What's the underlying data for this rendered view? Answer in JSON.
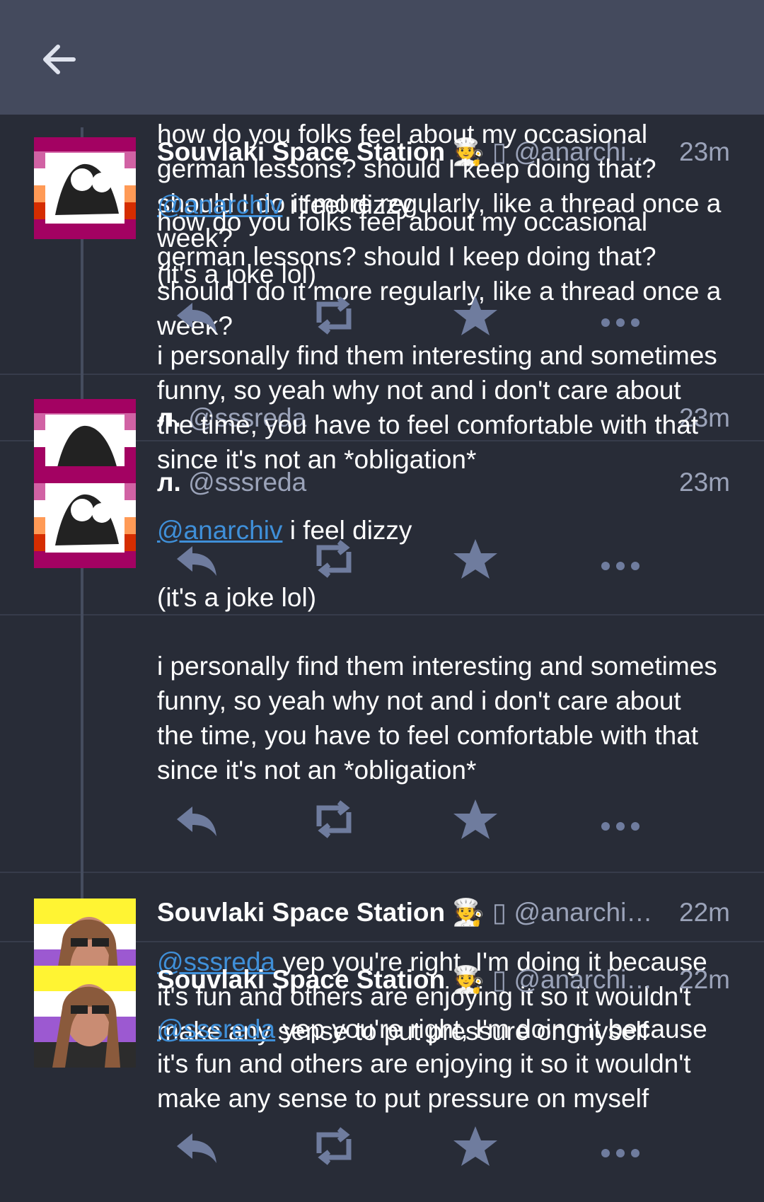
{
  "colors": {
    "background": "#282c37",
    "topbar": "#444a5d",
    "text": "#ffffff",
    "muted": "#9ba3b9",
    "mention": "#3f8fd8",
    "icon": "#6f7c9e"
  },
  "nav": {
    "back_icon": "arrow-left-icon"
  },
  "statuses": [
    {
      "display_name": "Souvlaki Space Station",
      "emoji": "🧑‍🍳",
      "glyph": "▯",
      "acct": "@anarchi…",
      "time": "23m",
      "body": "how do you folks feel about my occasional german lessons? should I keep doing that? should I do it more regularly, like a thread once a week?"
    },
    {
      "display_name": "Souvlaki Space Station",
      "emoji": "🧑‍🍳",
      "glyph": "▯",
      "acct": "@anarchi…",
      "time": "23m",
      "mention": "@anarchiv",
      "body_after_mention": "i feel dizzy",
      "body_part2": "how do you folks feel about my occasional german lessons? should I keep doing that? should I do it more regularly, like a thread once a week?",
      "note": "(it's a joke lol)"
    },
    {
      "display_name": "л.",
      "acct": "@sssreda",
      "time": "23m",
      "mention": "@anarchiv",
      "body_after_mention": "i feel dizzy",
      "note": "(it's a joke lol)",
      "body": "i personally find them interesting and sometimes funny, so yeah why not and i don't care about the time, you have to feel comfortable with that since it's not an *obligation*"
    },
    {
      "display_name": "л.",
      "acct": "@sssreda",
      "time": "23m",
      "mention": "@anarchiv",
      "body_after_mention": "i feel dizzy",
      "note": "(it's a joke lol)",
      "body": "i personally find them interesting and sometimes funny, so yeah why not and i don't care about the time, you have to feel comfortable with that since it's not an *obligation*"
    },
    {
      "display_name": "Souvlaki Space Station",
      "emoji": "🧑‍🍳",
      "glyph": "▯",
      "acct": "@anarchi…",
      "time": "22m",
      "mention": "@sssreda",
      "body_after_mention": "yep you're right, I'm doing it because it's fun and others are enjoying it so it wouldn't make any sense to put pressure on myself"
    },
    {
      "display_name": "Souvlaki Space Station",
      "emoji": "🧑‍🍳",
      "glyph": "▯",
      "acct": "@anarchi…",
      "time": "22m",
      "mention": "@sssreda",
      "body_after_mention": "yep you're right, I'm doing it because it's fun and others are enjoying it so it wouldn't make any sense to put pressure on myself"
    }
  ],
  "action_icons": [
    "reply-icon",
    "boost-icon",
    "favourite-icon",
    "more-icon"
  ]
}
